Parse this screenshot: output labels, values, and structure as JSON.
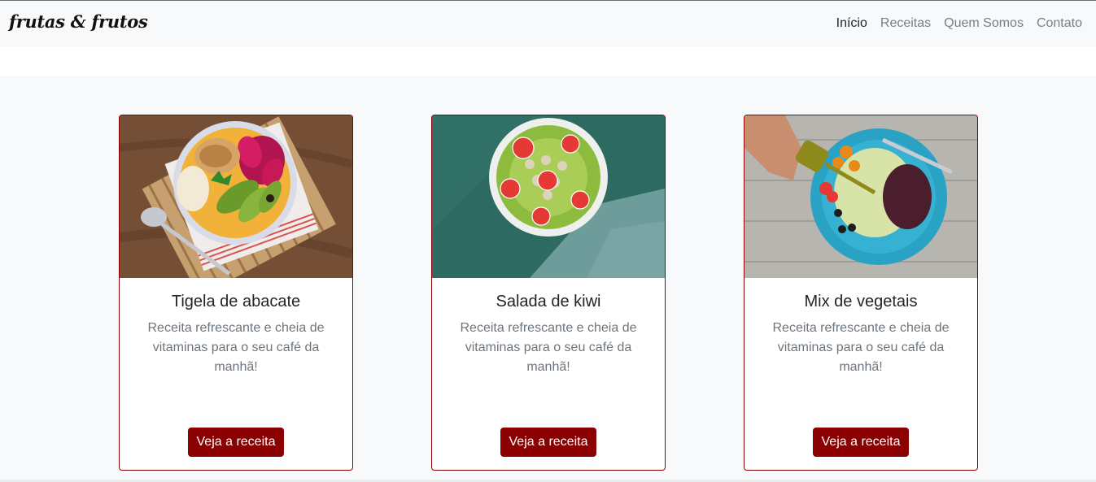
{
  "navbar": {
    "brand": "frutas & frutos",
    "links": [
      {
        "label": "Início",
        "active": true
      },
      {
        "label": "Receitas",
        "active": false
      },
      {
        "label": "Quem Somos",
        "active": false
      },
      {
        "label": "Contato",
        "active": false
      }
    ]
  },
  "cards": [
    {
      "title": "Tigela de abacate",
      "text": "Receita refrescante e cheia de vitaminas para o seu café da manhã!",
      "button": "Veja a receita",
      "image": "avocado-bowl-photo"
    },
    {
      "title": "Salada de kiwi",
      "text": "Receita refrescante e cheia de vitaminas para o seu café da manhã!",
      "button": "Veja a receita",
      "image": "kiwi-salad-photo"
    },
    {
      "title": "Mix de vegetais",
      "text": "Receita refrescante e cheia de vitaminas para o seu café da manhã!",
      "button": "Veja a receita",
      "image": "vegetable-mix-photo"
    }
  ],
  "colors": {
    "accent": "#8b0000",
    "navbar_bg": "#f8f9fa",
    "muted_text": "#6c757d"
  }
}
